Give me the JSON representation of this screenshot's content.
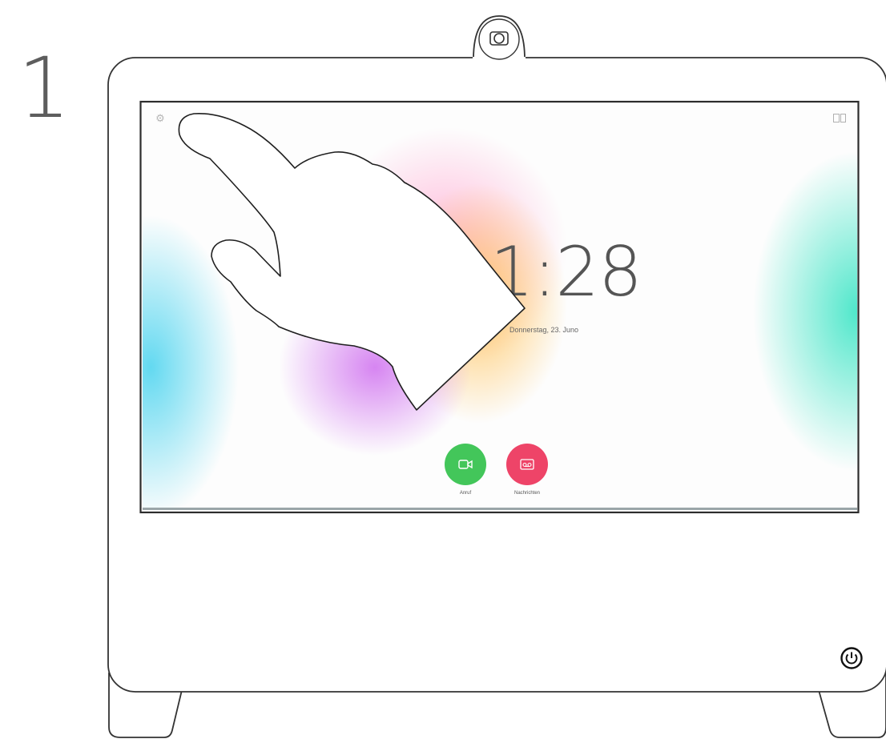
{
  "step_number": "1",
  "screen": {
    "clock": "11:28",
    "date": "Donnerstag, 23. Juno",
    "actions": [
      {
        "label": "Anruf",
        "icon": "video-camera-icon",
        "color": "#43c65a"
      },
      {
        "label": "Nachrichten",
        "icon": "voicemail-icon",
        "color": "#ee4468"
      }
    ],
    "top_left_icon": "gear-icon",
    "top_right_icon": "layout-icon"
  },
  "device": {
    "camera_icon": "camera-icon",
    "power_icon": "power-icon"
  }
}
